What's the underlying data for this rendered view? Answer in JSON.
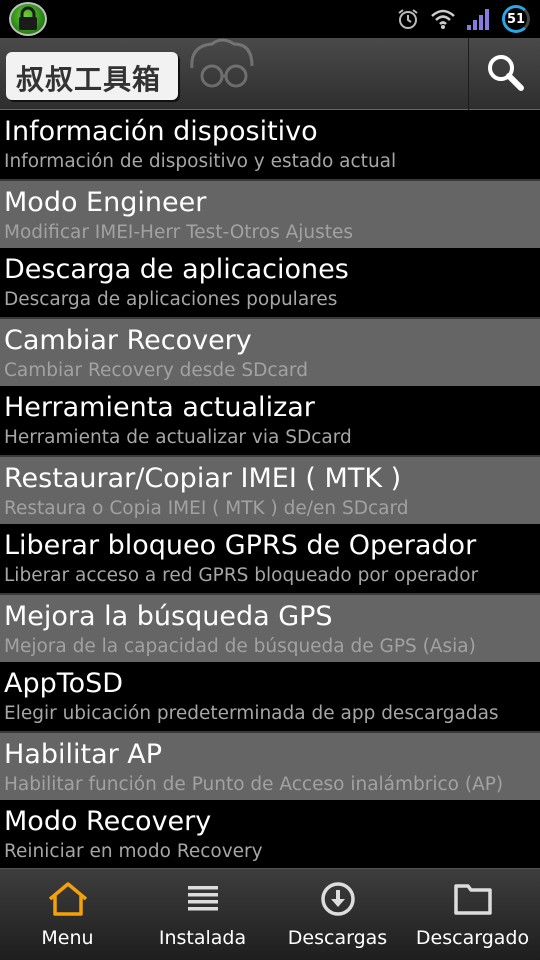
{
  "status_bar": {
    "battery_level": "51",
    "icons": [
      "lock-icon",
      "alarm-icon",
      "wifi-icon",
      "signal-icon",
      "battery-icon"
    ]
  },
  "app_bar": {
    "logo_text": "叔叔工具箱",
    "search_icon": "search-icon"
  },
  "menu": {
    "items": [
      {
        "title": "Información dispositivo",
        "subtitle": "Información de dispositivo y estado actual"
      },
      {
        "title": "Modo Engineer",
        "subtitle": "Modificar IMEI-Herr Test-Otros Ajustes"
      },
      {
        "title": "Descarga de aplicaciones",
        "subtitle": "Descarga de aplicaciones populares"
      },
      {
        "title": "Cambiar Recovery",
        "subtitle": "Cambiar Recovery desde SDcard"
      },
      {
        "title": "Herramienta actualizar",
        "subtitle": "Herramienta de actualizar via SDcard"
      },
      {
        "title": "Restaurar/Copiar IMEI ( MTK )",
        "subtitle": "Restaura o Copia IMEI ( MTK ) de/en SDcard"
      },
      {
        "title": "Liberar bloqueo GPRS de Operador",
        "subtitle": "Liberar acceso a red GPRS bloqueado por operador"
      },
      {
        "title": "Mejora la búsqueda GPS",
        "subtitle": "Mejora de la capacidad de búsqueda de GPS (Asia)"
      },
      {
        "title": "AppToSD",
        "subtitle": "Elegir ubicación predeterminada de app descargadas"
      },
      {
        "title": "Habilitar AP",
        "subtitle": "Habilitar función de Punto de Acceso inalámbrico (AP)"
      },
      {
        "title": "Modo Recovery",
        "subtitle": "Reiniciar en modo Recovery"
      }
    ]
  },
  "bottom_nav": {
    "items": [
      {
        "label": "Menu",
        "icon": "home-icon",
        "active": true
      },
      {
        "label": "Instalada",
        "icon": "list-icon"
      },
      {
        "label": "Descargas",
        "icon": "download-icon"
      },
      {
        "label": "Descargado",
        "icon": "folder-icon"
      }
    ]
  },
  "colors": {
    "accent": "#f5a20a",
    "alt_row": "#656565",
    "subtitle": "#a6a6a6",
    "battery_ring": "#2aa7e6"
  }
}
